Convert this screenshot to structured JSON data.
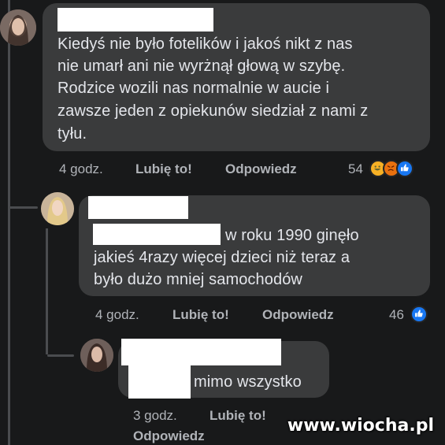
{
  "comments": [
    {
      "text_lines": [
        "Kiedyś nie było fotelików i jakoś nikt z nas",
        "nie umarł ani nie wyrżnął głową w szybę.",
        "Rodzice wozili nas normalnie w aucie i",
        "zawsze jeden z opiekunów siedział z nami z",
        "tyłu."
      ],
      "time": "4 godz.",
      "like_label": "Lubię to!",
      "reply_label": "Odpowiedz",
      "reaction_count": "54",
      "reactions": [
        "haha-icon",
        "angry-icon",
        "like-icon"
      ]
    },
    {
      "text_lines": [
        "w roku 1990 ginęło",
        "jakieś 4razy więcej dzieci niż teraz a",
        "było dużo mniej samochodów"
      ],
      "time": "4 godz.",
      "like_label": "Lubię to!",
      "reply_label": "Odpowiedz",
      "reaction_count": "46",
      "reactions": [
        "like-icon"
      ]
    },
    {
      "text_lines": [
        "mimo wszystko"
      ],
      "time": "3 godz.",
      "like_label": "Lubię to!",
      "reply_label": "Odpowiedz"
    }
  ],
  "watermark": "www.wiocha.pl",
  "colors": {
    "background": "#18191a",
    "bubble": "#3a3b3c",
    "text": "#e4e6eb",
    "meta": "#b0b3b8",
    "like_blue": "#1877f2"
  }
}
